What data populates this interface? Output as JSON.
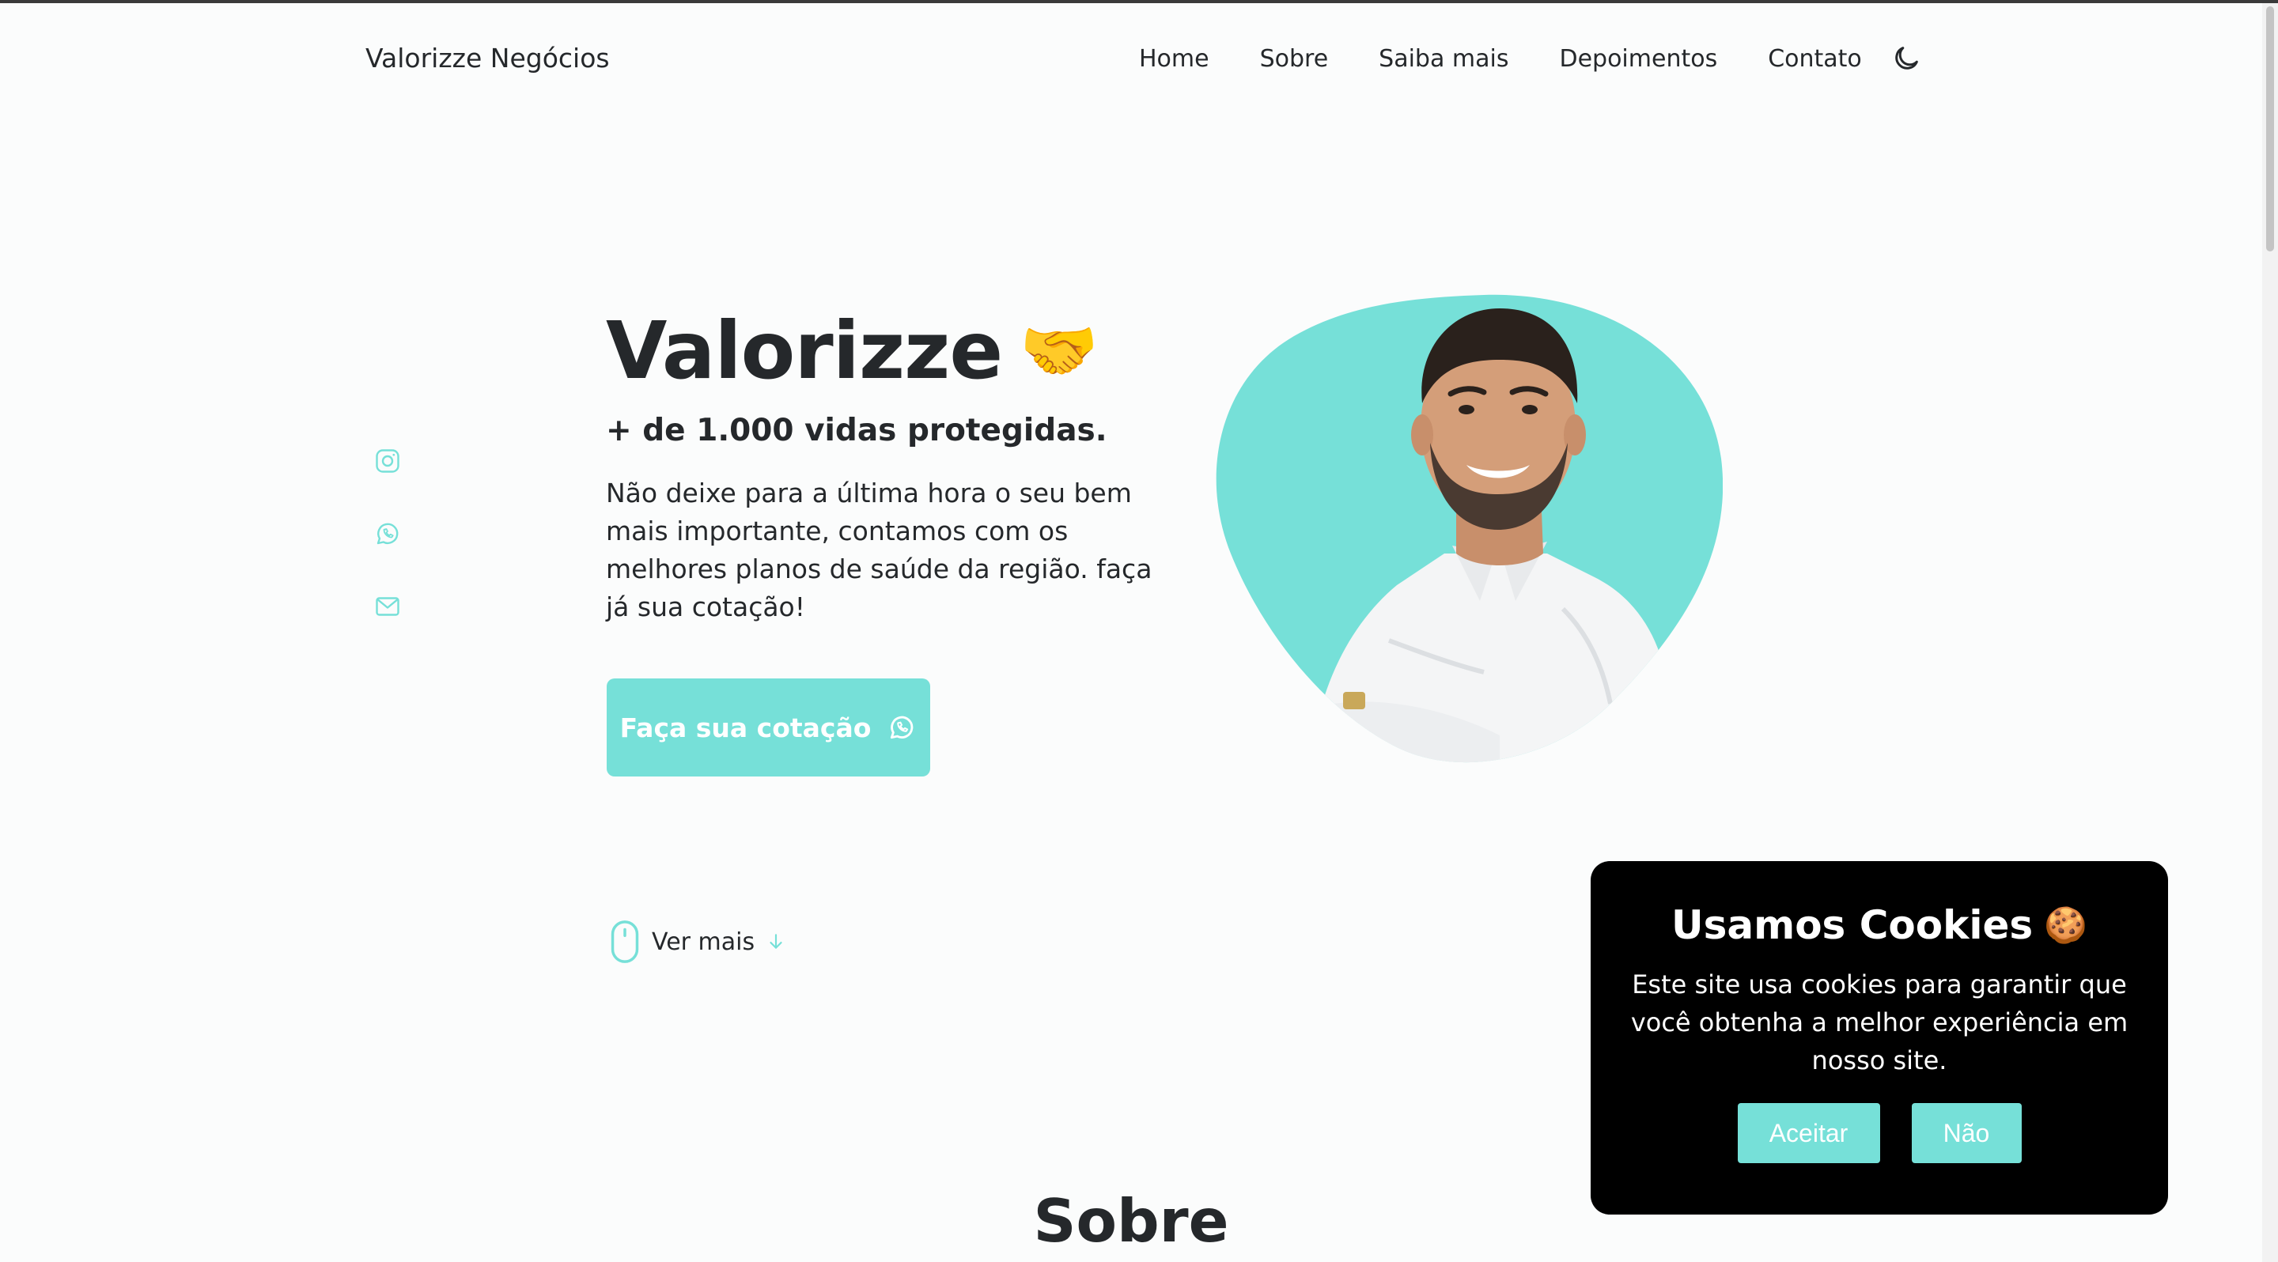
{
  "header": {
    "brand": "Valorizze Negócios",
    "nav": [
      "Home",
      "Sobre",
      "Saiba mais",
      "Depoimentos",
      "Contato"
    ],
    "theme_toggle_icon": "moon-icon"
  },
  "social": {
    "icons": [
      "instagram-icon",
      "whatsapp-icon",
      "mail-icon"
    ]
  },
  "hero": {
    "title": "Valorizze",
    "title_emoji": "🤝",
    "subtitle": "+ de 1.000 vidas protegidas.",
    "description": "Não deixe para a última hora o seu bem mais importante, contamos com os melhores planos de saúde da região. faça já sua cotação!",
    "cta_label": "Faça sua cotação",
    "scroll_label": "Ver mais"
  },
  "next_section": {
    "title": "Sobre"
  },
  "cookie_banner": {
    "title": "Usamos Cookies",
    "emoji": "🍪",
    "text": "Este site usa cookies para garantir que você obtenha a melhor experiência em nosso site.",
    "accept_label": "Aceitar",
    "reject_label": "Não"
  },
  "colors": {
    "accent": "#76e0d8",
    "text": "#25282b",
    "background": "#fbfcfc",
    "banner": "#000000"
  }
}
